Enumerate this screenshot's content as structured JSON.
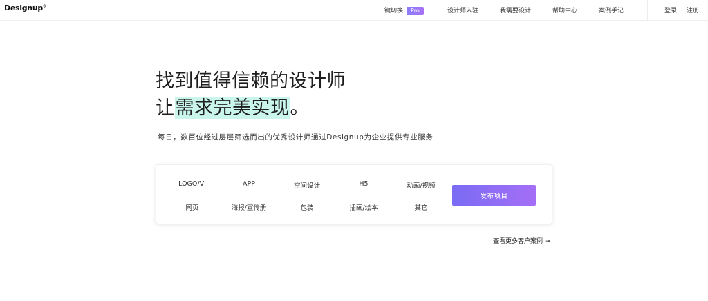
{
  "header": {
    "logo": "Designup",
    "logo_mark": "®",
    "switch_label": "一键切换",
    "pro_badge": "Pro",
    "nav": [
      "设计师入驻",
      "我需要设计",
      "帮助中心",
      "案例手记"
    ],
    "login": "登录",
    "register": "注册"
  },
  "hero": {
    "line1": "找到值得信赖的设计师",
    "line2_prefix": "让",
    "line2_highlight": "需求完美实现",
    "line2_suffix": "。",
    "subtitle": "每日，数百位经过层层筛选而出的优秀设计师通过Designup为企业提供专业服务"
  },
  "categories": {
    "row1": [
      "LOGO/VI",
      "APP",
      "空间设计",
      "H5",
      "动画/视频"
    ],
    "row2": [
      "网页",
      "海报/宣传册",
      "包装",
      "插画/绘本",
      "其它"
    ]
  },
  "publish_button": "发布项目",
  "more_cases": "查看更多客户案例",
  "more_arrow": "→",
  "colors": {
    "accent_start": "#7a6cf4",
    "accent_end": "#a56ef6",
    "highlight": "#c9f5ea"
  }
}
